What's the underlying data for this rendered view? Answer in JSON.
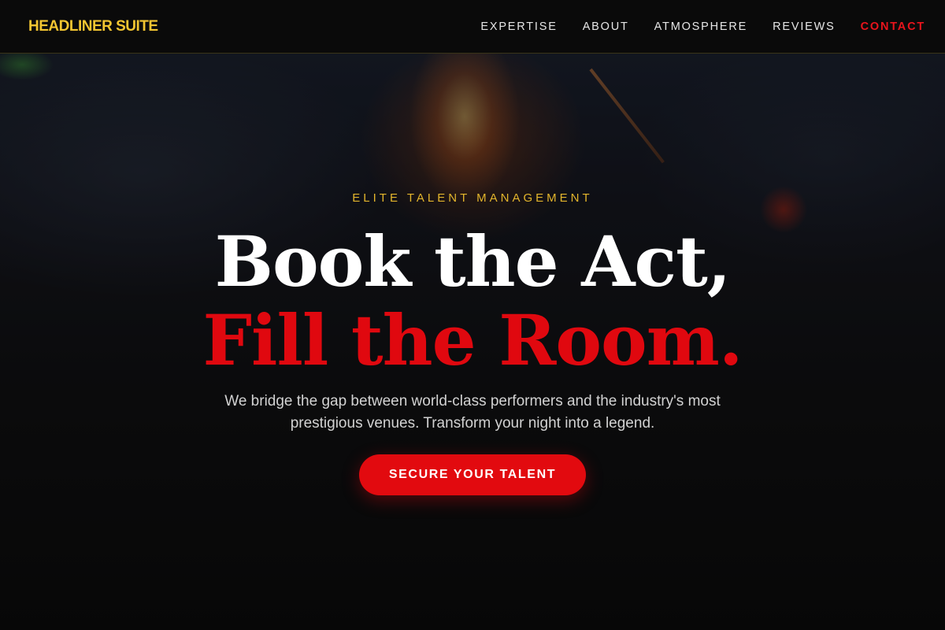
{
  "header": {
    "brand": "HEADLINER SUITE",
    "nav": [
      "EXPERTISE",
      "ABOUT",
      "ATMOSPHERE",
      "REVIEWS",
      "CONTACT"
    ]
  },
  "hero": {
    "eyebrow": "ELITE TALENT MANAGEMENT",
    "headline_line1": "Book the Act,",
    "headline_line2": "Fill the Room.",
    "subtext": "We bridge the gap between world-class performers and the industry's most prestigious venues. Transform your night into a legend.",
    "cta_label": "SECURE YOUR TALENT"
  },
  "colors": {
    "brand_yellow": "#f2c531",
    "accent_red": "#e0080f",
    "background": "#0b0b0b"
  }
}
